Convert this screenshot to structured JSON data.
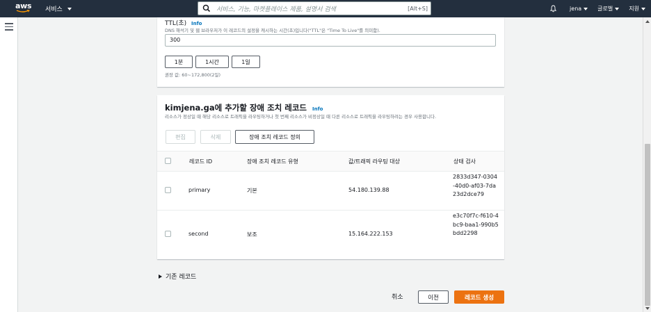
{
  "topnav": {
    "logo_text": "aws",
    "services_label": "서비스",
    "search_placeholder": "서비스, 기능, 마켓플레이스 제품, 설명서 검색",
    "search_shortcut": "[Alt+S]",
    "user_label": "jena",
    "region_label": "글로벌",
    "support_label": "지원"
  },
  "ttl": {
    "label": "TTL(초)",
    "info": "Info",
    "description": "DNS 해석기 및 웹 브라우저가 이 레코드의 설정을 캐시하는 시간(초)입니다(\"TTL\"은 \"Time To Live\"를 의미함).",
    "value": "300",
    "presets": [
      "1분",
      "1시간",
      "1일"
    ],
    "hint": "권장 값: 60~172,800(2일)"
  },
  "failover": {
    "title": "kimjena.ga에 추가할 장애 조치 레코드",
    "info": "Info",
    "description": "리소스가 정상일 때 해당 리소스로 트래픽을 라우팅하거나 첫 번째 리소스가 비정상일 때 다른 리소스로 트래픽을 라우팅하려는 경우 사용합니다.",
    "buttons": {
      "edit": "편집",
      "delete": "삭제",
      "define": "장애 조치 레코드 정의"
    },
    "columns": [
      "레코드 ID",
      "장애 조치 레코드 유형",
      "값/트래픽 라우팅 대상",
      "상태 검사"
    ],
    "rows": [
      {
        "id": "primary",
        "type": "기본",
        "value": "54.180.139.88",
        "health": "2833d347-0304-40d0-af03-7da23d2dce79"
      },
      {
        "id": "second",
        "type": "보조",
        "value": "15.164.222.153",
        "health": "e3c70f7c-f610-4bc9-baa1-990b5bdd2298"
      }
    ]
  },
  "existing_records_label": "기존 레코드",
  "footer": {
    "cancel": "취소",
    "previous": "이전",
    "create": "레코드 생성"
  },
  "colors": {
    "nav_bg": "#232f3e",
    "primary_button": "#ec7211",
    "link": "#0073bb"
  }
}
